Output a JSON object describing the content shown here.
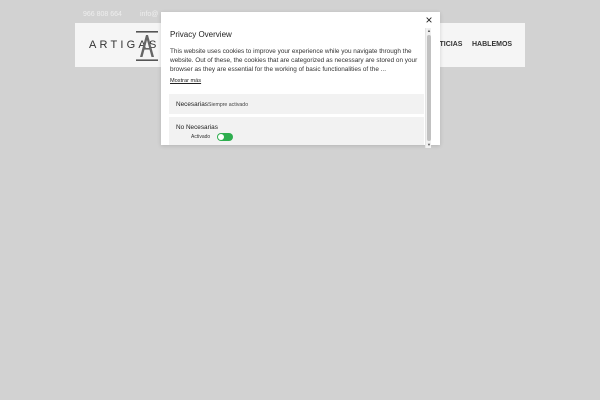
{
  "site": {
    "phone": "966 808 664",
    "email": "info@",
    "logo_text": "ARTIGAS",
    "nav": {
      "noticias": "NOTICIAS",
      "hablemos": "HABLEMOS"
    }
  },
  "dialog": {
    "title": "Privacy Overview",
    "description": "This website uses cookies to improve your experience while you navigate through the website. Out of these, the cookies that are categorized as necessary are stored on your browser as they are essential for the working of basic functionalities of the ...",
    "more_link": "Mostrar más",
    "close_icon": "×",
    "sections": {
      "necesarias": {
        "label": "Necesarias",
        "status": "Siempre activado"
      },
      "no_necesarias": {
        "label": "No Necesarias",
        "toggle_text": "Activado",
        "enabled": true
      }
    }
  },
  "colors": {
    "overlay_bg": "#d2d2d2",
    "toggle_on": "#2eae4f"
  }
}
